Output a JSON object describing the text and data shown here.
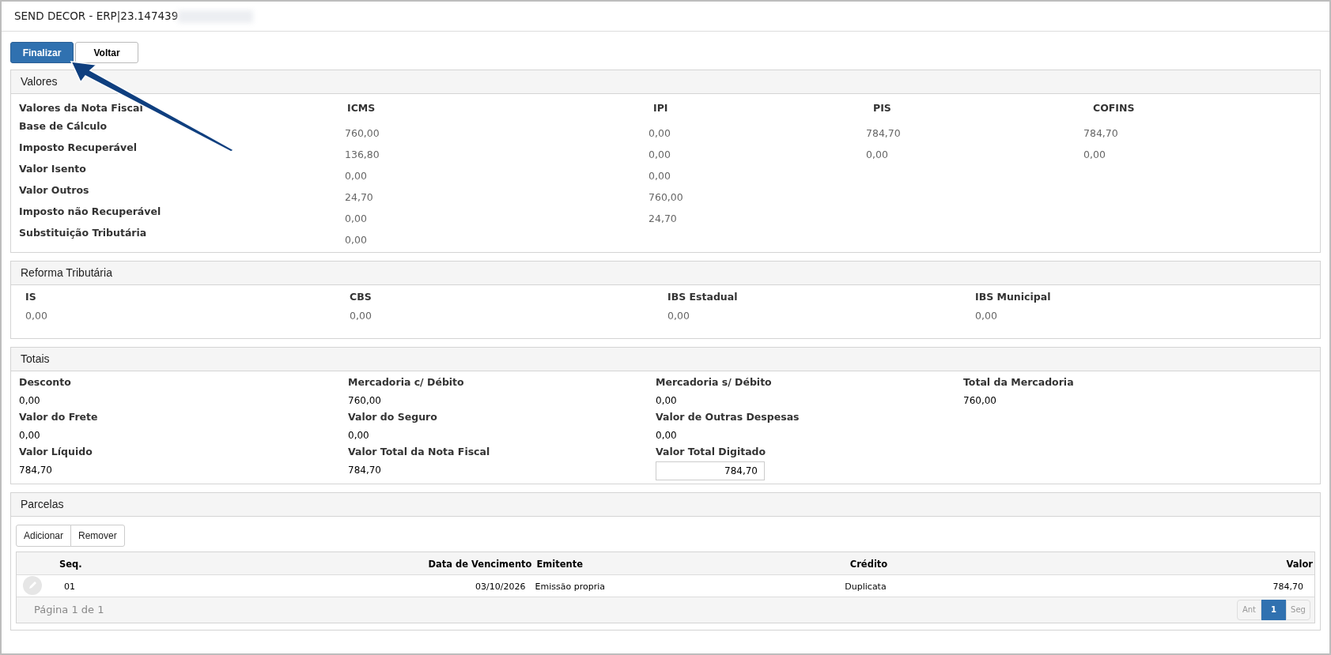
{
  "window": {
    "title": "SEND DECOR - ERP|23.147439"
  },
  "toolbar": [
    {
      "label": "Finalizar",
      "kind": "primary"
    },
    {
      "label": "Voltar",
      "kind": "default"
    }
  ],
  "valores": {
    "title": "Valores",
    "columns": [
      "Valores da Nota Fiscal",
      "ICMS",
      "IPI",
      "PIS",
      "COFINS"
    ],
    "rows": [
      {
        "label": "Base de Cálculo",
        "values": [
          "760,00",
          "0,00",
          "784,70",
          "784,70"
        ]
      },
      {
        "label": "Imposto Recuperável",
        "values": [
          "136,80",
          "0,00",
          "0,00",
          "0,00"
        ]
      },
      {
        "label": "Valor Isento",
        "values": [
          "0,00",
          "0,00"
        ]
      },
      {
        "label": "Valor Outros",
        "values": [
          "24,70",
          "760,00"
        ]
      },
      {
        "label": "Imposto não Recuperável",
        "values": [
          "0,00",
          "24,70"
        ]
      },
      {
        "label": "Substituição Tributária",
        "values": [
          "0,00"
        ]
      }
    ]
  },
  "reforma": {
    "title": "Reforma Tributária",
    "items": [
      {
        "label": "IS",
        "value": "0,00"
      },
      {
        "label": "CBS",
        "value": "0,00"
      },
      {
        "label": "IBS Estadual",
        "value": "0,00"
      },
      {
        "label": "IBS Municipal",
        "value": "0,00"
      }
    ]
  },
  "totais": {
    "title": "Totais",
    "rows": [
      [
        {
          "label": "Desconto",
          "value": "0,00",
          "kind": "text"
        },
        {
          "label": "Mercadoria c/ Débito",
          "value": "760,00",
          "kind": "text"
        },
        {
          "label": "Mercadoria s/ Débito",
          "value": "0,00",
          "kind": "text"
        },
        {
          "label": "Total da Mercadoria",
          "value": "760,00",
          "kind": "text"
        }
      ],
      [
        {
          "label": "Valor do Frete",
          "value": "0,00",
          "kind": "text"
        },
        {
          "label": "Valor do Seguro",
          "value": "0,00",
          "kind": "text"
        },
        {
          "label": "Valor de Outras Despesas",
          "value": "0,00",
          "kind": "text"
        }
      ],
      [
        {
          "label": "Valor Líquido",
          "value": "784,70",
          "kind": "text"
        },
        {
          "label": "Valor Total da Nota Fiscal",
          "value": "784,70",
          "kind": "text"
        },
        {
          "label": "Valor Total Digitado",
          "value": "784,70",
          "kind": "input"
        }
      ]
    ]
  },
  "parcelas": {
    "title": "Parcelas",
    "buttons": [
      "Adicionar",
      "Remover"
    ],
    "columns": [
      "Seq.",
      "Data de Vencimento",
      "Emitente",
      "Crédito",
      "Valor"
    ],
    "rows": [
      {
        "cells": [
          "01",
          "03/10/2026",
          "Emissão propria",
          "Duplicata",
          "784,70"
        ]
      }
    ],
    "page_info": "Página 1 de 1",
    "pagination": [
      {
        "label": "Ant",
        "selected": false
      },
      {
        "label": "1",
        "selected": true
      },
      {
        "label": "Seg",
        "selected": false
      }
    ]
  }
}
